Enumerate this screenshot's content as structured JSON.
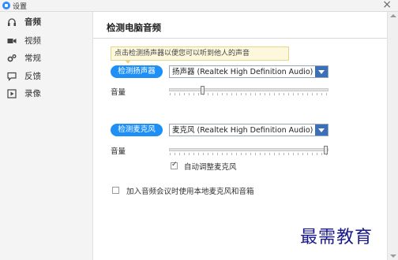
{
  "window": {
    "title": "设置",
    "close_glyph": "×"
  },
  "sidebar": {
    "items": [
      {
        "label": "音频",
        "icon": "headphones-icon",
        "active": true
      },
      {
        "label": "视频",
        "icon": "video-icon",
        "active": false
      },
      {
        "label": "常规",
        "icon": "gear-icon",
        "active": false
      },
      {
        "label": "反馈",
        "icon": "chat-icon",
        "active": false
      },
      {
        "label": "录像",
        "icon": "record-icon",
        "active": false
      }
    ]
  },
  "main": {
    "title": "检测电脑音频",
    "tooltip": "点击检测扬声器以便您可以听到他人的声音",
    "speaker": {
      "test_button": "检测扬声器",
      "device": "扬声器 (Realtek High Definition Audio)",
      "volume_label": "音量",
      "volume_level": 0.2
    },
    "microphone": {
      "test_button": "检测麦克风",
      "device": "麦克风 (Realtek High Definition Audio)",
      "volume_label": "音量",
      "volume_level": 1.0,
      "auto_adjust_label": "自动调整麦克风",
      "auto_adjust_checked": true
    },
    "join_audio_label": "加入音频会议时使用本地麦克风和音箱",
    "join_audio_checked": false
  },
  "watermark": "最需教育",
  "colors": {
    "accent": "#1e90f5",
    "dropdown_arrow": "#3b6fb8",
    "tooltip_bg": "#fdf8dc"
  }
}
